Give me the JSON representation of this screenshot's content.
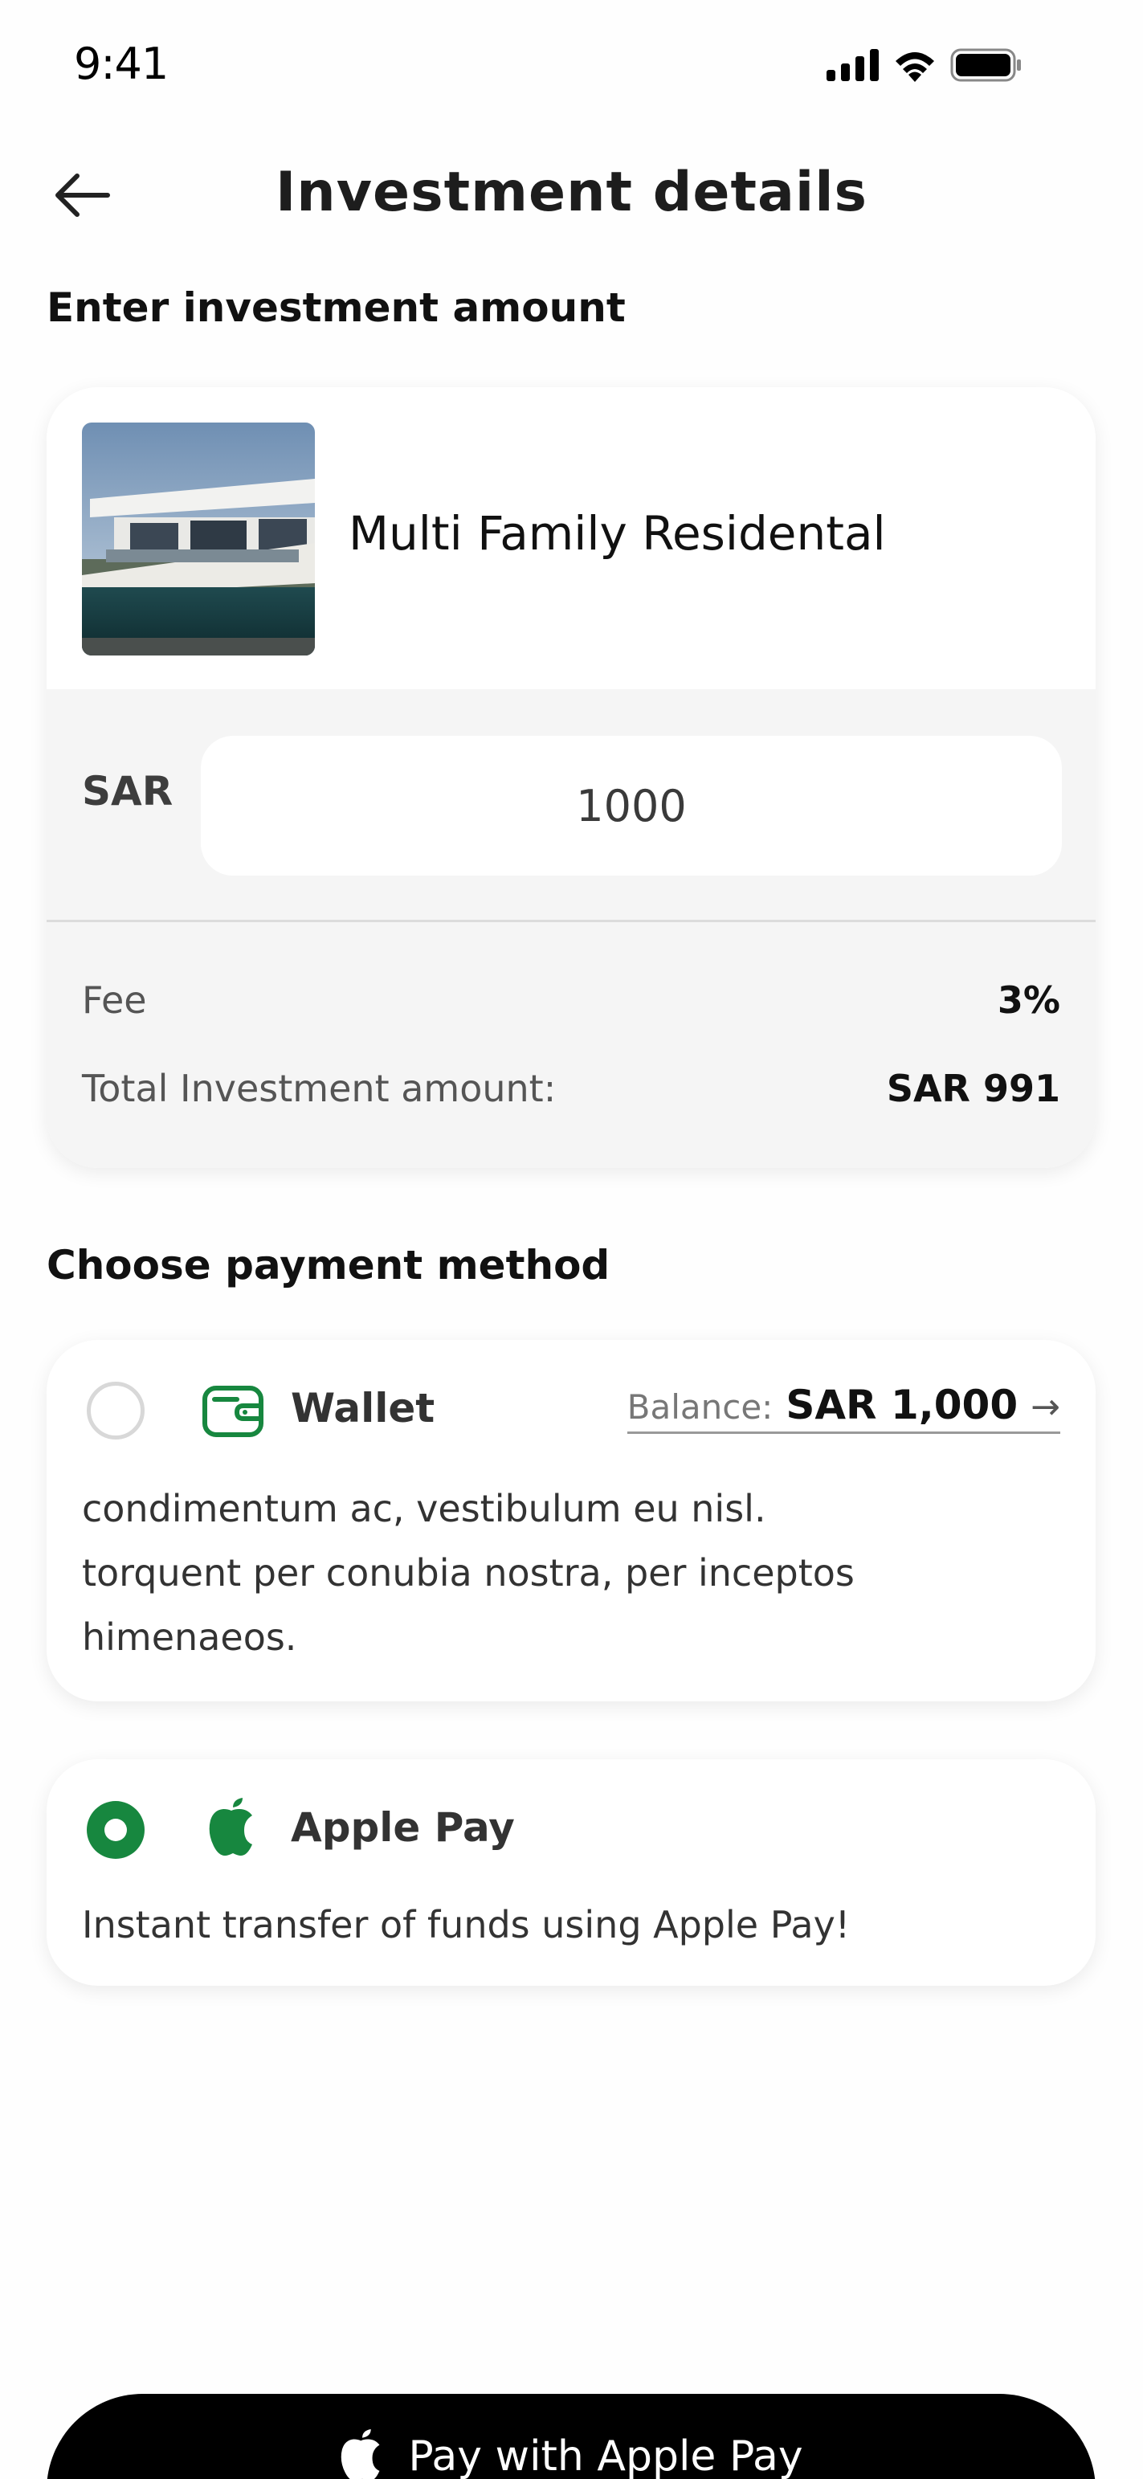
{
  "status_bar": {
    "time": "9:41",
    "icons": [
      "signal-icon",
      "wifi-icon",
      "battery-icon"
    ]
  },
  "header": {
    "title": "Investment details",
    "back_icon": "arrow-left-icon"
  },
  "investment": {
    "section_title": "Enter investment amount",
    "property_name": "Multi Family Residental",
    "currency": "SAR",
    "amount": "1000",
    "fee_label": "Fee",
    "fee_value": "3%",
    "total_label": "Total Investment amount:",
    "total_value": "SAR 991"
  },
  "payment": {
    "section_title": "Choose payment method",
    "methods": [
      {
        "name": "Wallet",
        "icon": "wallet-icon",
        "selected": false,
        "balance_label": "Balance:",
        "balance_value": "SAR 1,000",
        "balance_arrow": "→",
        "description_lines": [
          "condimentum ac, vestibulum eu nisl.",
          "torquent per conubia nostra, per inceptos",
          "himenaeos."
        ]
      },
      {
        "name": "Apple Pay",
        "icon": "apple-icon",
        "selected": true,
        "description_lines": [
          "Instant transfer of funds using Apple Pay!"
        ]
      }
    ]
  },
  "cta": {
    "label": "Pay with Apple Pay",
    "icon": "apple-icon"
  },
  "colors": {
    "accent_green": "#17873f",
    "button_black": "#000000",
    "panel_gray": "#f5f5f5"
  }
}
